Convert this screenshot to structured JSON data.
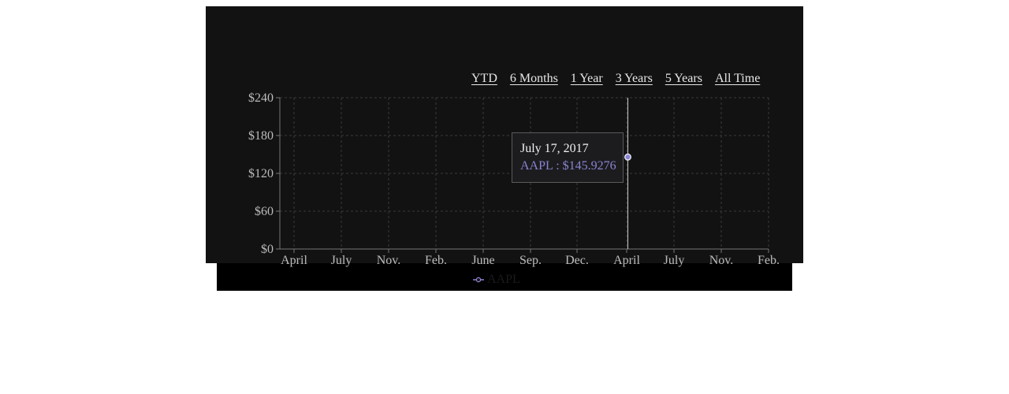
{
  "range_buttons": [
    "YTD",
    "6 Months",
    "1 Year",
    "3 Years",
    "5 Years",
    "All Time"
  ],
  "tooltip": {
    "date": "July 17, 2017",
    "value": "AAPL : $145.9276"
  },
  "legend": {
    "label": "AAPL"
  },
  "colors": {
    "panel_bg": "#121212",
    "series": "#8a84d0",
    "grid": "#3a3a3a",
    "axis": "#777777",
    "tick_text": "#bcbcbc"
  },
  "chart_data": {
    "type": "line",
    "title": "",
    "xlabel": "",
    "ylabel": "",
    "ylim": [
      0,
      240
    ],
    "y_ticks": [
      "$0",
      "$60",
      "$120",
      "$180",
      "$240"
    ],
    "x_tick_labels": [
      "April",
      "July",
      "Nov.",
      "Feb.",
      "June",
      "Sep.",
      "Dec.",
      "April",
      "July",
      "Nov.",
      "Feb."
    ],
    "grid": true,
    "series": [
      {
        "name": "AAPL",
        "points": [
          {
            "x": "2017-07-17",
            "y": 145.9276
          }
        ]
      }
    ],
    "hover": {
      "x": "2017-07-17",
      "y": 145.9276
    }
  }
}
